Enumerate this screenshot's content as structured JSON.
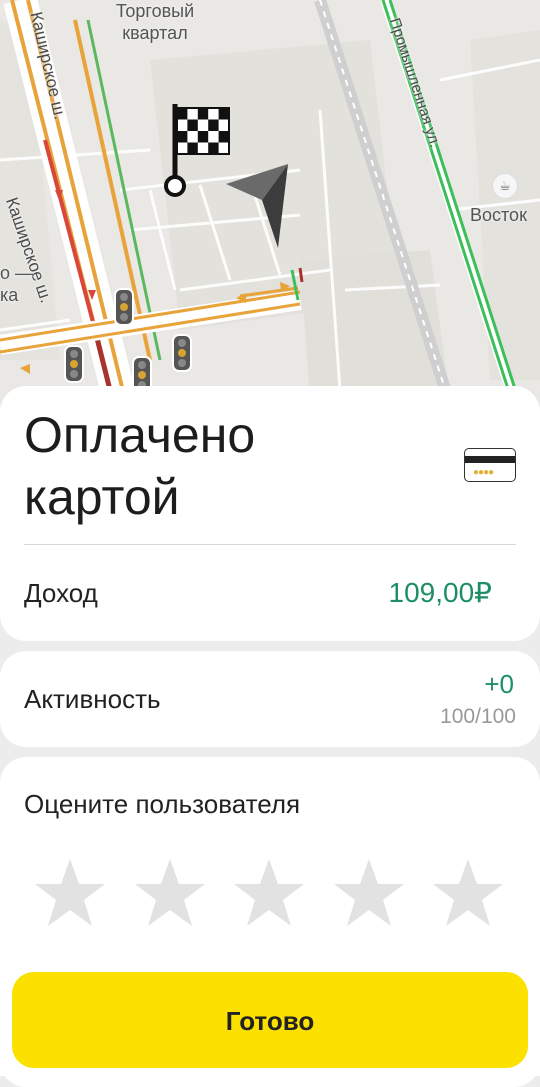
{
  "map": {
    "labels": {
      "district": "Торговый\nквартал",
      "road_kashirskoe_main": "Каширское ш.",
      "road_kashirskoe_side": "Каширское ш.",
      "street_promyshlennaya": "Промышленная ул.",
      "poi_vostok": "Восток",
      "partial_left": "о —\nка"
    },
    "icons": {
      "destination": "checkered-flag-icon",
      "user_position": "navigation-arrow-icon",
      "cafe": "coffee-cup-icon",
      "traffic_light": "traffic-light-icon"
    }
  },
  "payment": {
    "title": "Оплачено картой",
    "method_icon": "bank-card-icon",
    "income_label": "Доход",
    "income_value": "109,00₽"
  },
  "activity": {
    "label": "Активность",
    "delta": "+0",
    "score": "100/100"
  },
  "rating": {
    "title": "Оцените пользователя",
    "max_stars": 5,
    "selected": 0
  },
  "actions": {
    "done_label": "Готово"
  },
  "colors": {
    "accent_yellow": "#fce000",
    "positive_green": "#1e8f64",
    "star_inactive": "#e2e2e2"
  }
}
